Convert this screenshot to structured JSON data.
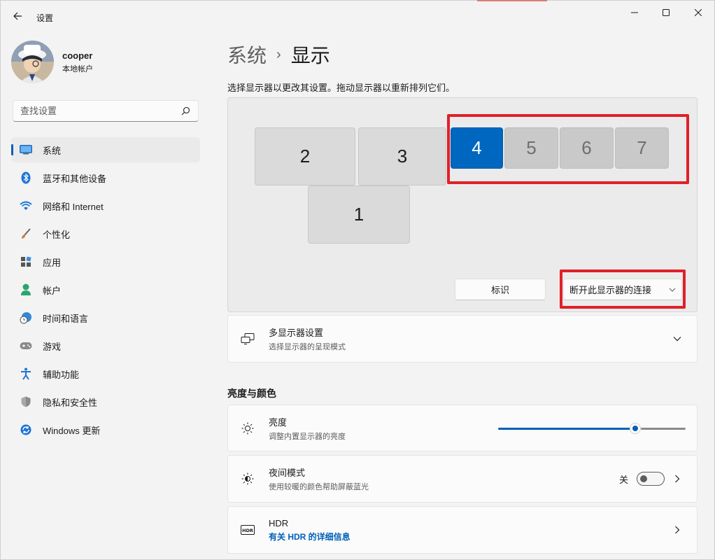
{
  "window": {
    "title": "设置",
    "controls": {
      "minimize": "minimize-icon",
      "maximize": "maximize-icon",
      "close": "close-icon"
    }
  },
  "profile": {
    "name": "cooper",
    "account_type": "本地帐户"
  },
  "search": {
    "placeholder": "查找设置"
  },
  "sidebar": {
    "items": [
      {
        "label": "系统",
        "icon": "system-icon",
        "active": true
      },
      {
        "label": "蓝牙和其他设备",
        "icon": "bluetooth-icon"
      },
      {
        "label": "网络和 Internet",
        "icon": "wifi-icon"
      },
      {
        "label": "个性化",
        "icon": "brush-icon"
      },
      {
        "label": "应用",
        "icon": "apps-icon"
      },
      {
        "label": "帐户",
        "icon": "account-icon"
      },
      {
        "label": "时间和语言",
        "icon": "clock-globe-icon"
      },
      {
        "label": "游戏",
        "icon": "gamepad-icon"
      },
      {
        "label": "辅助功能",
        "icon": "accessibility-icon"
      },
      {
        "label": "隐私和安全性",
        "icon": "shield-icon"
      },
      {
        "label": "Windows 更新",
        "icon": "update-icon"
      }
    ]
  },
  "breadcrumb": {
    "parent": "系统",
    "separator": "›",
    "current": "显示"
  },
  "display": {
    "instruction": "选择显示器以更改其设置。拖动显示器以重新排列它们。",
    "monitors": [
      {
        "label": "2",
        "state": "normal"
      },
      {
        "label": "3",
        "state": "normal"
      },
      {
        "label": "4",
        "state": "selected"
      },
      {
        "label": "5",
        "state": "inactive"
      },
      {
        "label": "6",
        "state": "inactive"
      },
      {
        "label": "7",
        "state": "inactive"
      },
      {
        "label": "1",
        "state": "normal"
      }
    ],
    "identify_button": "标识",
    "connection_dropdown": "断开此显示器的连接"
  },
  "multi_display": {
    "title": "多显示器设置",
    "subtitle": "选择显示器的呈现模式"
  },
  "brightness_section": {
    "title": "亮度与颜色",
    "brightness": {
      "title": "亮度",
      "subtitle": "调整内置显示器的亮度",
      "level": 0.73
    },
    "night_light": {
      "title": "夜间模式",
      "subtitle": "使用较暖的颜色帮助屏蔽蓝光",
      "state_label": "关",
      "on": false
    },
    "hdr": {
      "title": "HDR",
      "link": "有关 HDR 的详细信息"
    }
  },
  "colors": {
    "accent": "#005fb8",
    "selected_monitor": "#0067c0",
    "highlight": "#e0202a"
  }
}
